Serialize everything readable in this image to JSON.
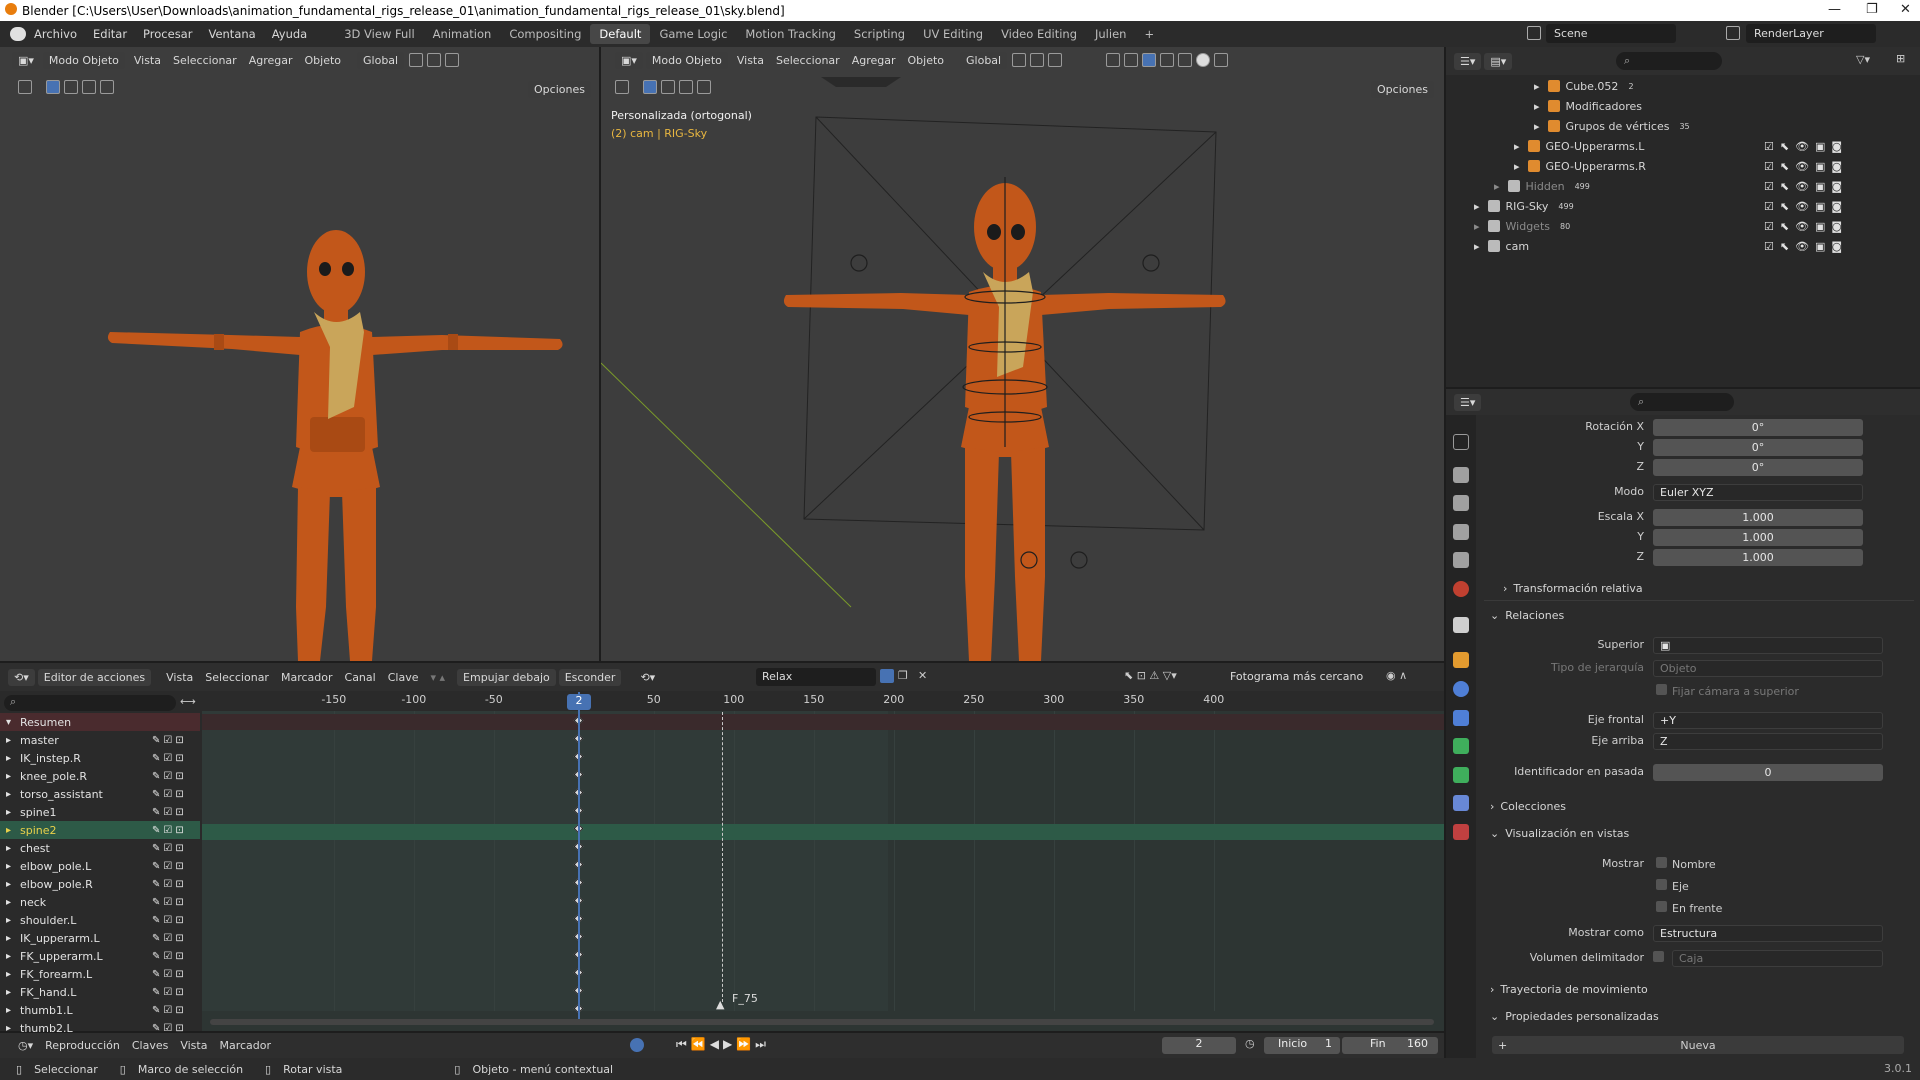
{
  "title_bar": {
    "text": "Blender [C:\\Users\\User\\Downloads\\animation_fundamental_rigs_release_01\\animation_fundamental_rigs_release_01\\sky.blend]",
    "minimize": "—",
    "maximize": "❐",
    "close": "✕"
  },
  "menus": [
    "Archivo",
    "Editar",
    "Procesar",
    "Ventana",
    "Ayuda"
  ],
  "workspaces": [
    "3D View Full",
    "Animation",
    "Compositing",
    "Default",
    "Game Logic",
    "Motion Tracking",
    "Scripting",
    "UV Editing",
    "Video Editing",
    "Julien",
    "+"
  ],
  "active_workspace": "Default",
  "scene": {
    "name": "Scene",
    "render_layer": "RenderLayer"
  },
  "viewport_left": {
    "mode": "Modo Objeto",
    "menus": [
      "Vista",
      "Seleccionar",
      "Agregar",
      "Objeto"
    ],
    "orientation": "Global",
    "options": "Opciones"
  },
  "viewport_right": {
    "mode": "Modo Objeto",
    "menus": [
      "Vista",
      "Seleccionar",
      "Agregar",
      "Objeto"
    ],
    "orientation": "Global",
    "options": "Opciones",
    "view_label": "Personalizada (ortogonal)",
    "view_sub": "(2) cam | RIG-Sky"
  },
  "outliner": {
    "rows": [
      {
        "label": "Cube.052",
        "indent": 4,
        "badge": "2"
      },
      {
        "label": "Modificadores",
        "indent": 4
      },
      {
        "label": "Grupos de vértices",
        "indent": 4,
        "badge": "35"
      },
      {
        "label": "GEO-Upperarms.L",
        "indent": 3
      },
      {
        "label": "GEO-Upperarms.R",
        "indent": 3
      },
      {
        "label": "Hidden",
        "indent": 2,
        "badge": "499",
        "dim": true
      },
      {
        "label": "RIG-Sky",
        "indent": 1,
        "badge": "499"
      },
      {
        "label": "Widgets",
        "indent": 1,
        "badge": "80",
        "dim": true
      },
      {
        "label": "cam",
        "indent": 1
      }
    ]
  },
  "properties": {
    "rotation": {
      "label_x": "Rotación X",
      "label_y": "Y",
      "label_z": "Z",
      "x": "0°",
      "y": "0°",
      "z": "0°"
    },
    "mode": {
      "label": "Modo",
      "value": "Euler XYZ"
    },
    "scale": {
      "label_x": "Escala X",
      "label_y": "Y",
      "label_z": "Z",
      "x": "1.000",
      "y": "1.000",
      "z": "1.000"
    },
    "sections": {
      "relative": "Transformación relativa",
      "relations": "Relaciones",
      "collections": "Colecciones",
      "viewport_display": "Visualización en vistas",
      "motion_path": "Trayectoria de movimiento",
      "custom_props": "Propiedades personalizadas"
    },
    "parent": {
      "label": "Superior"
    },
    "parent_type": {
      "label": "Tipo de jerarquía",
      "value": "Objeto"
    },
    "fix_camera": "Fijar cámara a superior",
    "track_axis": {
      "label": "Eje frontal",
      "value": "+Y"
    },
    "up_axis": {
      "label": "Eje arriba",
      "value": "Z"
    },
    "pass_index": {
      "label": "Identificador en pasada",
      "value": "0"
    },
    "show": {
      "label": "Mostrar",
      "name": "Nombre",
      "axis": "Eje",
      "front": "En frente"
    },
    "display_as": {
      "label": "Mostrar como",
      "value": "Estructura"
    },
    "bounds": {
      "label": "Volumen delimitador",
      "value": "Caja"
    },
    "new_button": "Nueva"
  },
  "action_editor": {
    "editor": "Editor de acciones",
    "menus": [
      "Vista",
      "Seleccionar",
      "Marcador",
      "Canal",
      "Clave"
    ],
    "push_down": "Empujar debajo",
    "stash": "Esconder",
    "action_name": "Relax",
    "snap": "Fotograma más cercano",
    "ruler": [
      "-150",
      "-100",
      "-50",
      "50",
      "100",
      "150",
      "200",
      "250",
      "300",
      "350",
      "400"
    ],
    "current_frame_label": "2",
    "marker": "F_75",
    "channels": [
      "Resumen",
      "master",
      "IK_instep.R",
      "knee_pole.R",
      "torso_assistant",
      "spine1",
      "spine2",
      "chest",
      "elbow_pole.L",
      "elbow_pole.R",
      "neck",
      "shoulder.L",
      "IK_upperarm.L",
      "FK_upperarm.L",
      "FK_forearm.L",
      "FK_hand.L",
      "thumb1.L",
      "thumb2.L"
    ],
    "selected_channel": "spine2"
  },
  "playback": {
    "menus": [
      "Reproducción",
      "Claves",
      "Vista",
      "Marcador"
    ],
    "frame": "2",
    "start_label": "Inicio",
    "start": "1",
    "end_label": "Fin",
    "end": "160"
  },
  "status_bar": {
    "select": "Seleccionar",
    "box": "Marco de selección",
    "rotate": "Rotar vista",
    "context": "Objeto - menú contextual",
    "version": "3.0.1"
  },
  "colors": {
    "accent": "#4772b3",
    "selected_channel": "#2d5a47",
    "character": "#c2571a",
    "scarf": "#c9a55a"
  }
}
